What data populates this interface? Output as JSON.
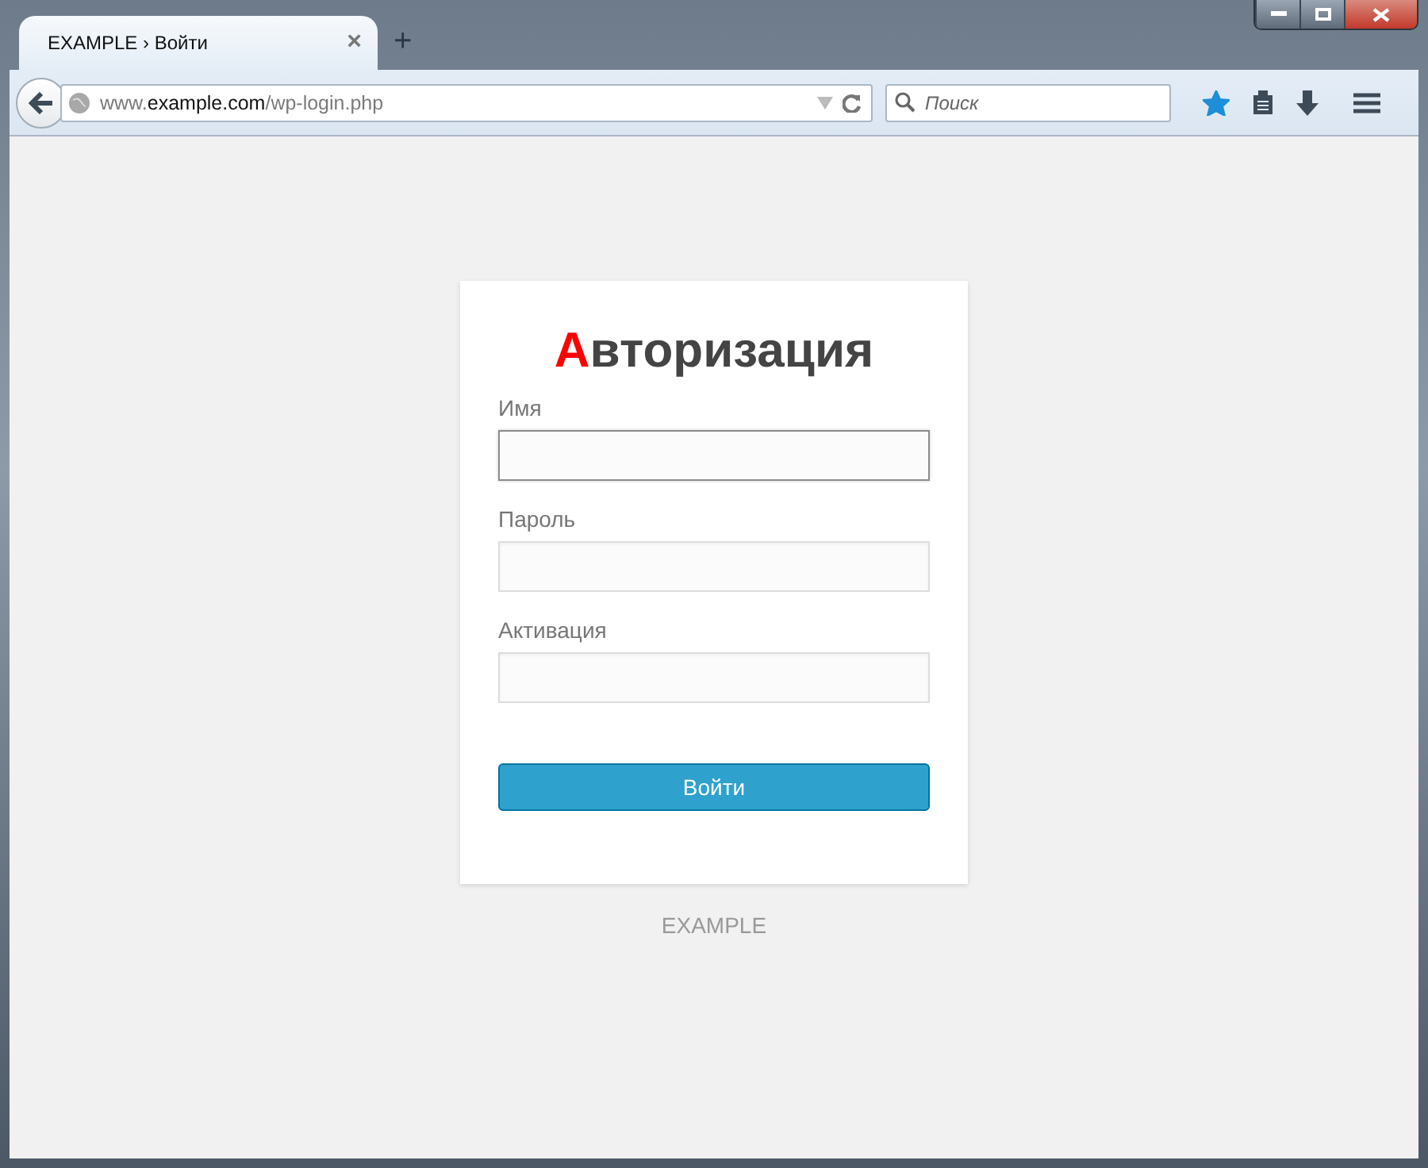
{
  "browser": {
    "tabs": [
      {
        "title": "EXAMPLE › Войти",
        "selected": true
      }
    ],
    "close_tab": "×",
    "new_tab": "+",
    "url": {
      "prefix": "www.",
      "domain": "example.com",
      "path": "/wp-login.php"
    },
    "search": {
      "placeholder": "Поиск"
    },
    "bookmarked": true
  },
  "login": {
    "title": "Авторизация",
    "fields": [
      {
        "label": "Имя",
        "focused": true
      },
      {
        "label": "Пароль",
        "focused": false
      },
      {
        "label": "Активация",
        "focused": false
      }
    ],
    "submit": "Войти"
  },
  "footer": "EXAMPLE"
}
